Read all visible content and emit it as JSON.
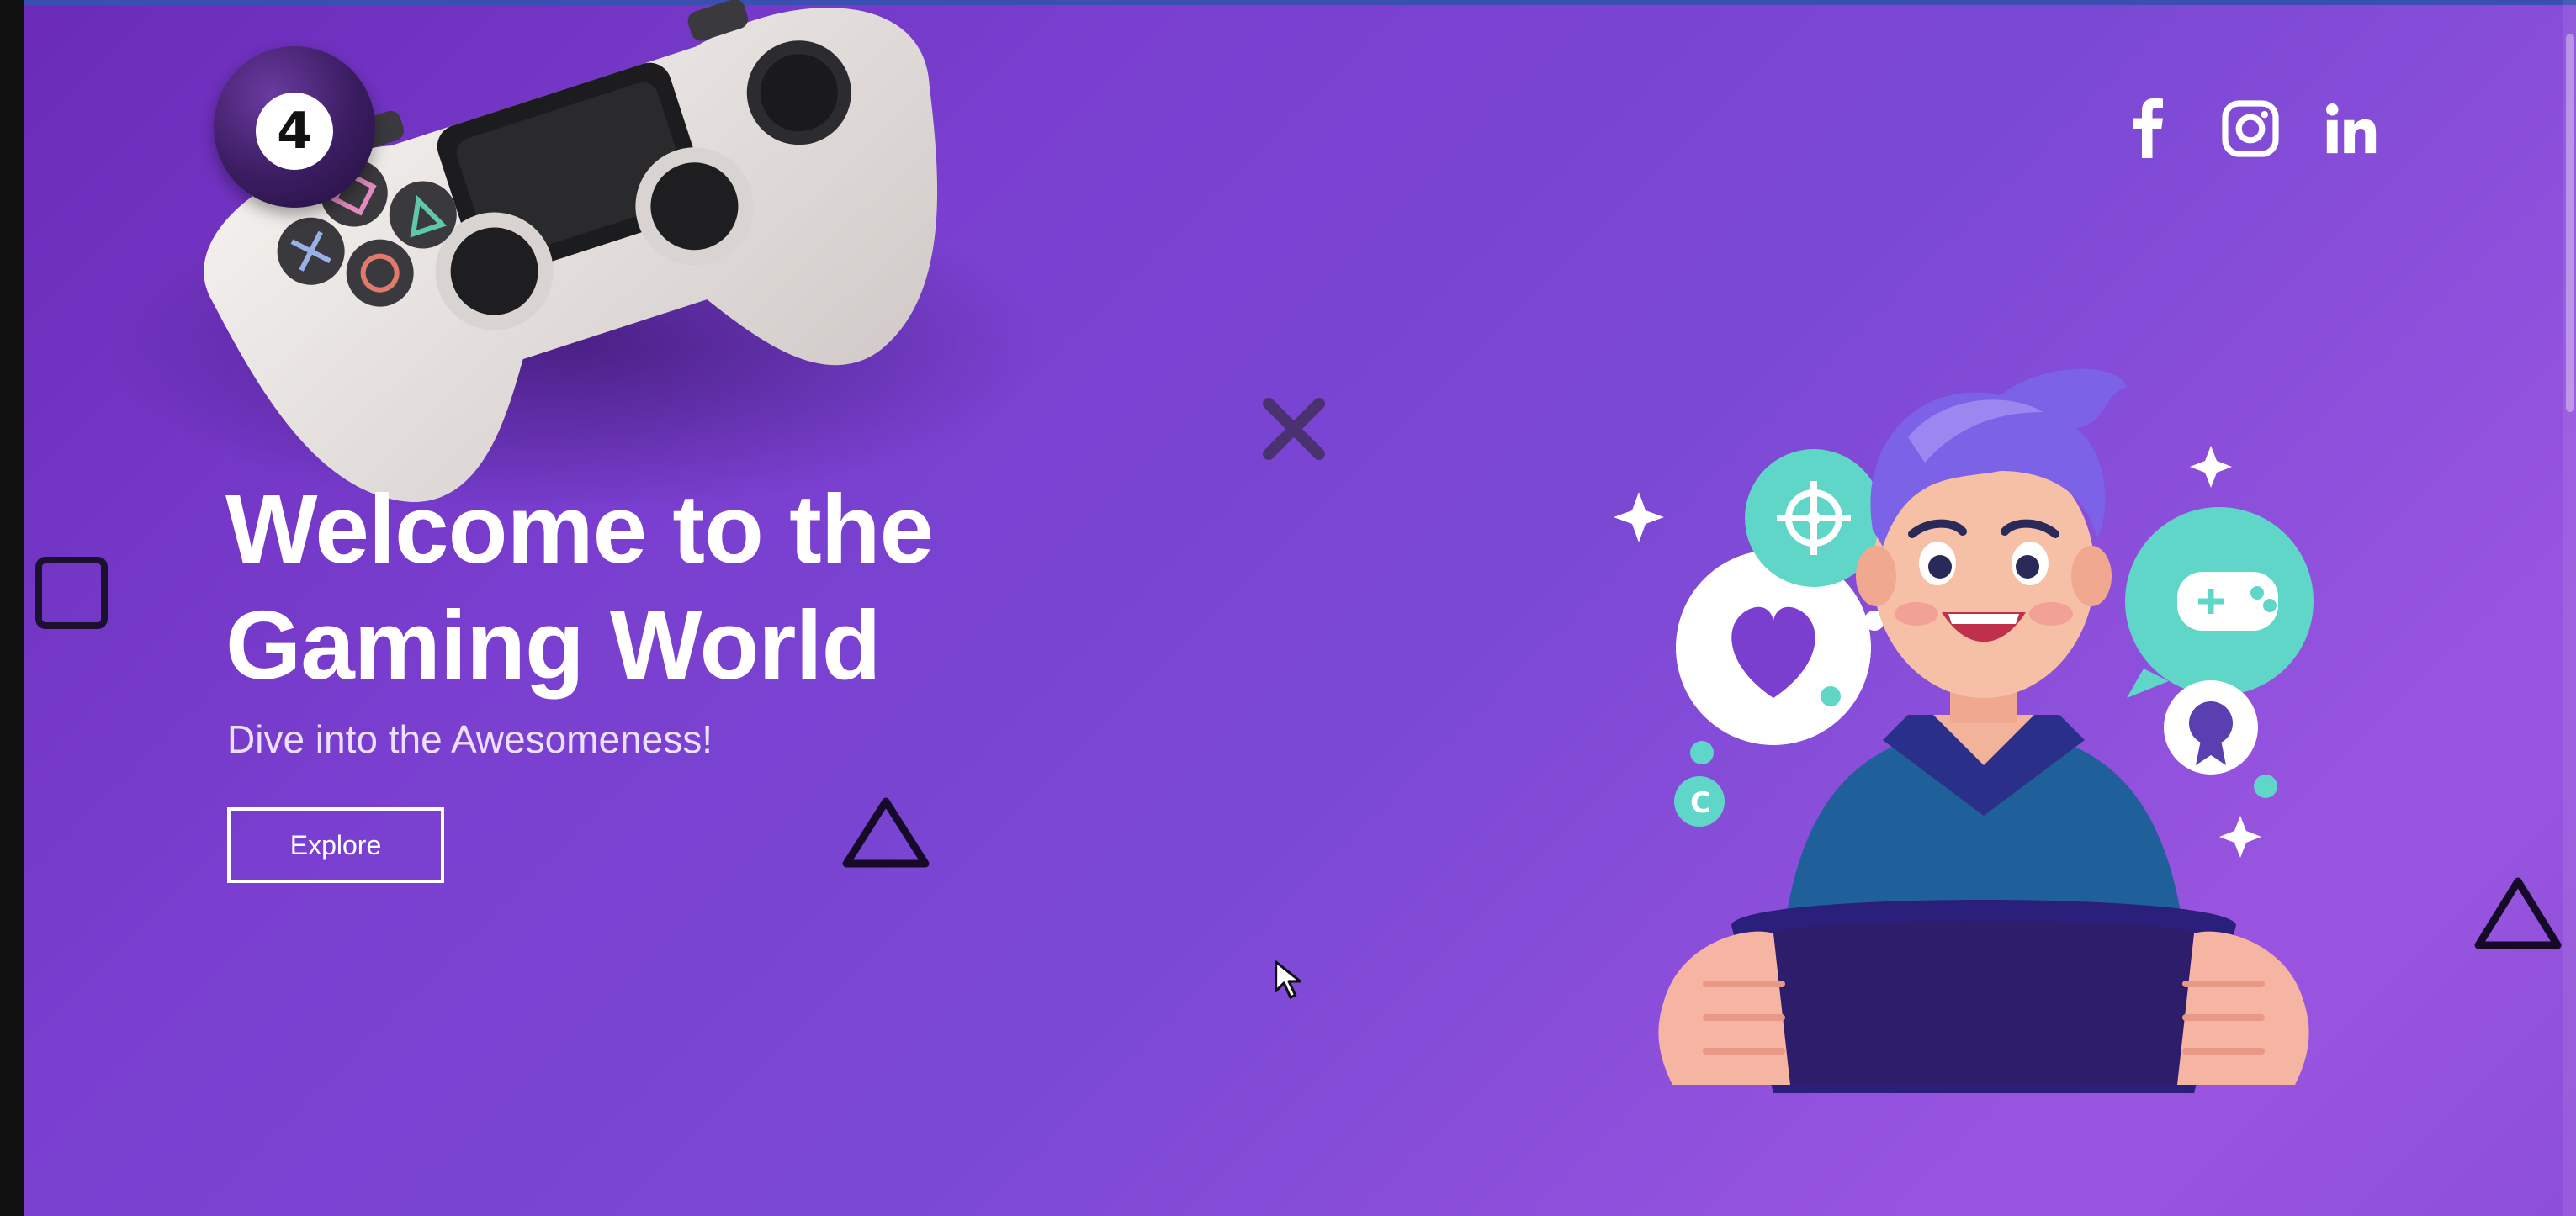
{
  "header": {
    "logo_text": "4",
    "social": [
      {
        "name": "facebook",
        "icon": "facebook-icon"
      },
      {
        "name": "instagram",
        "icon": "instagram-icon"
      },
      {
        "name": "linkedin",
        "icon": "linkedin-icon"
      }
    ]
  },
  "hero": {
    "headline_line1": "Welcome to the",
    "headline_line2": "Gaming World",
    "subheadline": "Dive into the Awesomeness!",
    "cta_label": "Explore"
  },
  "decorations": [
    "square-shape",
    "x-shape",
    "triangle-shape",
    "triangle-shape"
  ],
  "colors": {
    "bg_start": "#6b2bb8",
    "bg_end": "#9a55e0",
    "accent_teal": "#5fd6c8",
    "text": "#ffffff"
  }
}
